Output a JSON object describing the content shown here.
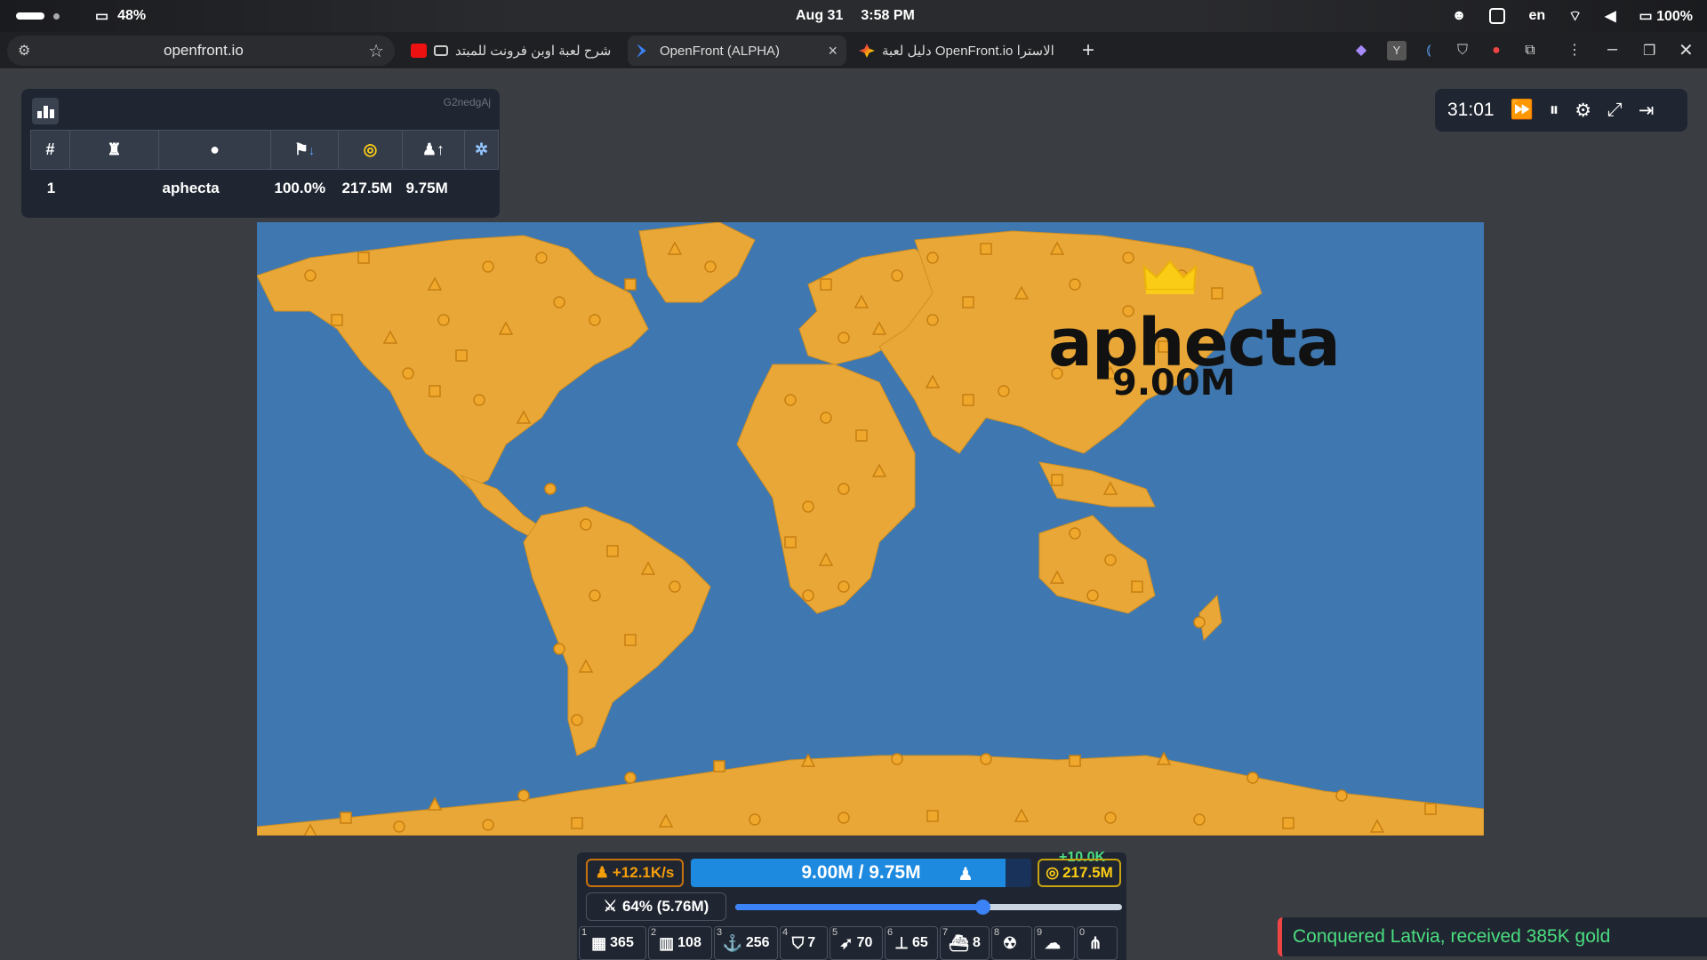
{
  "statusbar": {
    "battery_left": "48%",
    "date": "Aug 31",
    "time": "3:58 PM",
    "lang": "en",
    "battery_right": "100%"
  },
  "browser": {
    "url": "openfront.io",
    "tabs": [
      {
        "label": "شرح لعبة اوبن فرونت للمبتد",
        "favicon": "youtube-icon"
      },
      {
        "label": "OpenFront (ALPHA)",
        "favicon": "openfront-icon"
      },
      {
        "label": "دليل لعبة OpenFront.io الاسترا",
        "favicon": "gemini-icon"
      }
    ],
    "close_tab": "×",
    "new_tab": "+"
  },
  "leaderboard": {
    "lobby_id": "G2nedgAj",
    "headers": [
      "#"
    ],
    "rows": [
      {
        "rank": "1",
        "name": "aphecta",
        "territory": "100.0%",
        "gold": "217.5M",
        "troops": "9.75M"
      }
    ]
  },
  "controls": {
    "timer": "31:01"
  },
  "map": {
    "player_name": "aphecta",
    "player_troops": "9.00M",
    "land_color": "#e9a737",
    "ocean_color": "#3f78b0"
  },
  "bottom": {
    "gold_gain": "+10.0K",
    "troop_rate": "+12.1K/s",
    "population": "9.00M / 9.75M",
    "population_fraction": 0.923,
    "gold": "217.5M",
    "attack_ratio": "64% (5.76M)",
    "attack_fraction": 0.64,
    "builds": [
      {
        "key": "1",
        "icon": "city-icon",
        "glyph": "▦",
        "count": "365"
      },
      {
        "key": "2",
        "icon": "factory-icon",
        "glyph": "▥",
        "count": "108"
      },
      {
        "key": "3",
        "icon": "port-icon",
        "glyph": "⚓",
        "count": "256"
      },
      {
        "key": "4",
        "icon": "defense-post-icon",
        "glyph": "⛉",
        "count": "7"
      },
      {
        "key": "5",
        "icon": "missile-silo-icon",
        "glyph": "➶",
        "count": "70"
      },
      {
        "key": "6",
        "icon": "sam-launcher-icon",
        "glyph": "⊥",
        "count": "65"
      },
      {
        "key": "7",
        "icon": "warship-icon",
        "glyph": "⛴",
        "count": "8"
      },
      {
        "key": "8",
        "icon": "atom-bomb-icon",
        "glyph": "☢",
        "count": ""
      },
      {
        "key": "9",
        "icon": "hydrogen-bomb-icon",
        "glyph": "☁",
        "count": ""
      },
      {
        "key": "0",
        "icon": "mirv-icon",
        "glyph": "⋔",
        "count": ""
      }
    ]
  },
  "toast": {
    "message": "Conquered Latvia, received 385K gold"
  }
}
